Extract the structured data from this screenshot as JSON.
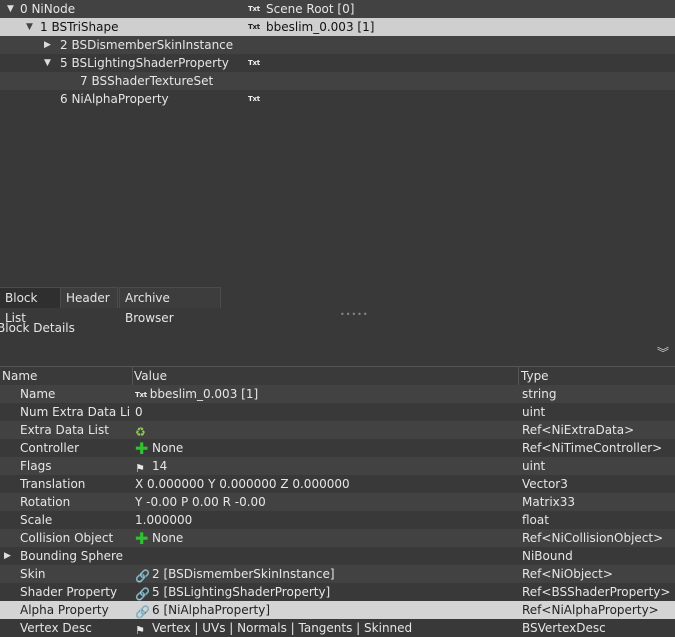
{
  "tree": {
    "rows": [
      {
        "indent": 0,
        "arrow": "▼",
        "label": "0 NiNode",
        "value": "Scene Root [0]",
        "has_txt": true
      },
      {
        "indent": 1,
        "arrow": "▼",
        "label": "1 BSTriShape",
        "value": "bbeslim_0.003 [1]",
        "has_txt": true
      },
      {
        "indent": 2,
        "arrow": "▶",
        "label": "2 BSDismemberSkinInstance",
        "value": "",
        "has_txt": false
      },
      {
        "indent": 2,
        "arrow": "▼",
        "label": "5 BSLightingShaderProperty",
        "value": "",
        "has_txt": true
      },
      {
        "indent": 3,
        "arrow": "",
        "label": "7 BSShaderTextureSet",
        "value": "",
        "has_txt": false
      },
      {
        "indent": 2,
        "arrow": "",
        "label": "6 NiAlphaProperty",
        "value": "",
        "has_txt": true
      }
    ],
    "txt_glyph": "Txt"
  },
  "tabs": [
    {
      "label": "Block List"
    },
    {
      "label": "Header"
    },
    {
      "label": "Archive Browser"
    }
  ],
  "splitter_glyph": "•••••",
  "details": {
    "title": "Block Details",
    "collapse_glyph": "︾",
    "columns": {
      "name": "Name",
      "value": "Value",
      "type": "Type"
    },
    "rows": [
      {
        "name": "Name",
        "icon": "txt",
        "value": "bbeslim_0.003 [1]",
        "type": "string"
      },
      {
        "name": "Num Extra Data List",
        "icon": "",
        "value": "0",
        "type": "uint"
      },
      {
        "name": "Extra Data List",
        "icon": "recycle",
        "value": "",
        "type": "Ref<NiExtraData>"
      },
      {
        "name": "Controller",
        "icon": "plus",
        "value": "None",
        "type": "Ref<NiTimeController>"
      },
      {
        "name": "Flags",
        "icon": "flag",
        "value": "14",
        "type": "uint"
      },
      {
        "name": "Translation",
        "icon": "",
        "value": "X 0.000000 Y 0.000000 Z 0.000000",
        "type": "Vector3"
      },
      {
        "name": "Rotation",
        "icon": "",
        "value": "Y -0.00 P 0.00 R -0.00",
        "type": "Matrix33"
      },
      {
        "name": "Scale",
        "icon": "",
        "value": "1.000000",
        "type": "float"
      },
      {
        "name": "Collision Object",
        "icon": "plus",
        "value": "None",
        "type": "Ref<NiCollisionObject>"
      },
      {
        "name": "Bounding Sphere",
        "icon": "",
        "value": "",
        "type": "NiBound",
        "expander": "▶"
      },
      {
        "name": "Skin",
        "icon": "link",
        "value": "2 [BSDismemberSkinInstance]",
        "type": "Ref<NiObject>"
      },
      {
        "name": "Shader Property",
        "icon": "link",
        "value": "5 [BSLightingShaderProperty]",
        "type": "Ref<BSShaderProperty>"
      },
      {
        "name": "Alpha Property",
        "icon": "link",
        "value": "6 [NiAlphaProperty]",
        "type": "Ref<NiAlphaProperty>"
      },
      {
        "name": "Vertex Desc",
        "icon": "flag",
        "value": "Vertex | UVs | Normals | Tangents | Skinned",
        "type": "BSVertexDesc"
      }
    ]
  }
}
